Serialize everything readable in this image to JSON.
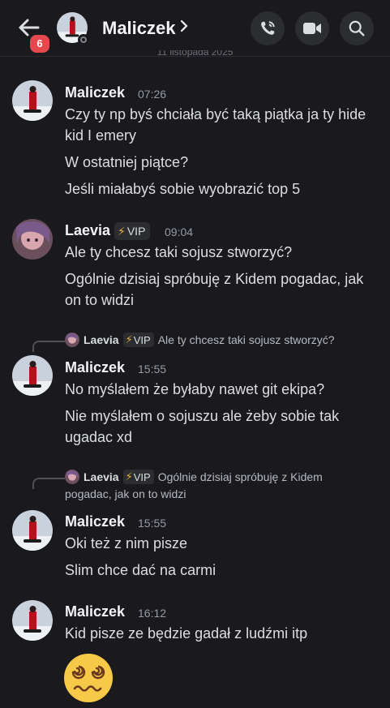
{
  "header": {
    "back_badge": "6",
    "channel_name": "Maliczek",
    "chevron": "›",
    "icons": [
      "back-arrow-icon",
      "phone-call-icon",
      "video-camera-icon",
      "search-icon"
    ]
  },
  "date_separator": "11 listopada 2025",
  "messages": [
    {
      "author": "Maliczek",
      "time": "07:26",
      "lines": [
        "Czy ty np byś chciała być taką piątka ja ty hide kid I emery",
        "W ostatniej piątce?",
        "Jeśli miałabyś sobie wyobrazić top 5"
      ]
    },
    {
      "author": "Laevia",
      "vip": "VIP",
      "time": "09:04",
      "lines": [
        "Ale ty chcesz taki sojusz stworzyć?",
        "Ogólnie dzisiaj spróbuję z Kidem pogadac, jak on to widzi"
      ]
    },
    {
      "reply": {
        "author": "Laevia",
        "vip": "VIP",
        "text": "Ale ty chcesz taki sojusz stworzyć?"
      },
      "author": "Maliczek",
      "time": "15:55",
      "lines": [
        "No myślałem że byłaby nawet git ekipa?",
        "Nie myślałem o sojuszu ale żeby sobie tak ugadac xd"
      ]
    },
    {
      "reply": {
        "author": "Laevia",
        "vip": "VIP",
        "text_line1": "Ogólnie dzisiaj spróbuję z Kidem",
        "text_line2": "pogadac, jak on to widzi"
      },
      "author": "Maliczek",
      "time": "15:55",
      "lines": [
        "Oki też z nim pisze",
        "Slim chce dać na carmi"
      ]
    },
    {
      "author": "Maliczek",
      "time": "16:12",
      "lines": [
        "Kid pisze ze będzie gadał z ludźmi itp"
      ],
      "emoji": "woozy-face-emoji"
    }
  ],
  "colors": {
    "background": "#1a1a1e",
    "badge": "#e5484d",
    "vip_bolt": "#f0b232",
    "emoji_yellow": "#f7c948"
  }
}
